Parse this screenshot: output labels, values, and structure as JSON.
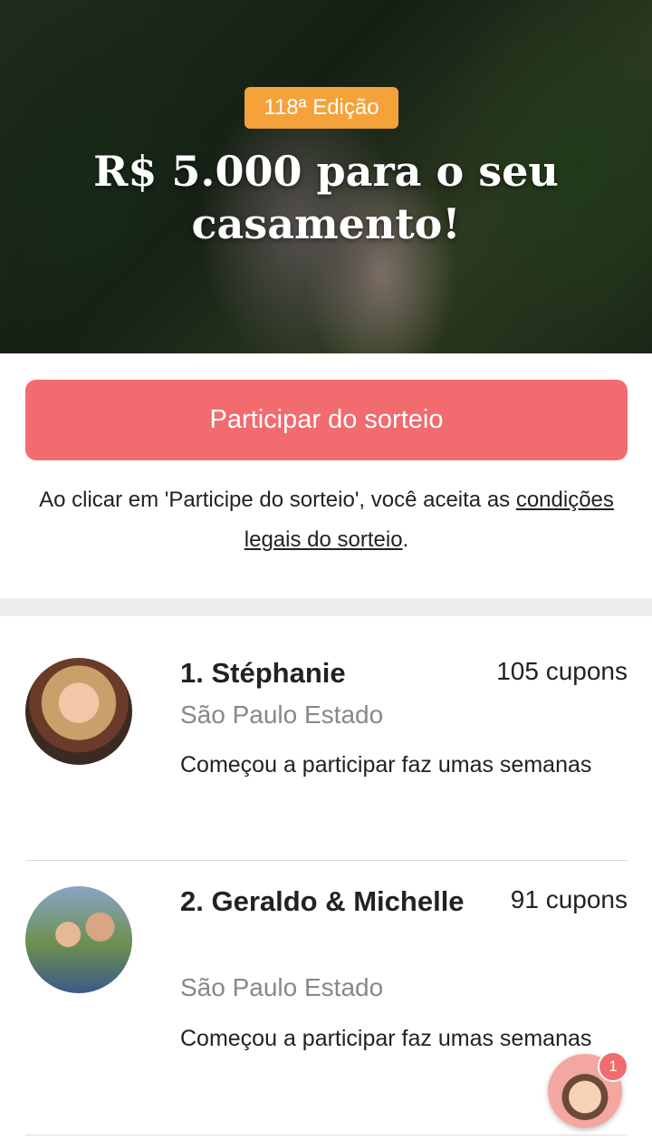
{
  "hero": {
    "edition_badge": "118ª Edição",
    "title": "R$ 5.000 para o seu casamento!"
  },
  "cta": {
    "label": "Participar do sorteio"
  },
  "terms": {
    "prefix": "Ao clicar em 'Participe do sorteio', você aceita as ",
    "link": "condições legais do sorteio",
    "suffix": "."
  },
  "ranking": [
    {
      "name": "1. Stéphanie",
      "coupons": "105 cupons",
      "region": "São Paulo Estado",
      "since": "Começou a participar faz umas semanas"
    },
    {
      "name": "2. Geraldo & Michelle",
      "coupons": "91 cupons",
      "region": "São Paulo Estado",
      "since": "Começou a participar faz umas semanas"
    }
  ],
  "helper": {
    "notification_count": "1"
  },
  "colors": {
    "accent": "#f16b6f",
    "badge": "#f5a23a",
    "muted_text": "#888888"
  }
}
